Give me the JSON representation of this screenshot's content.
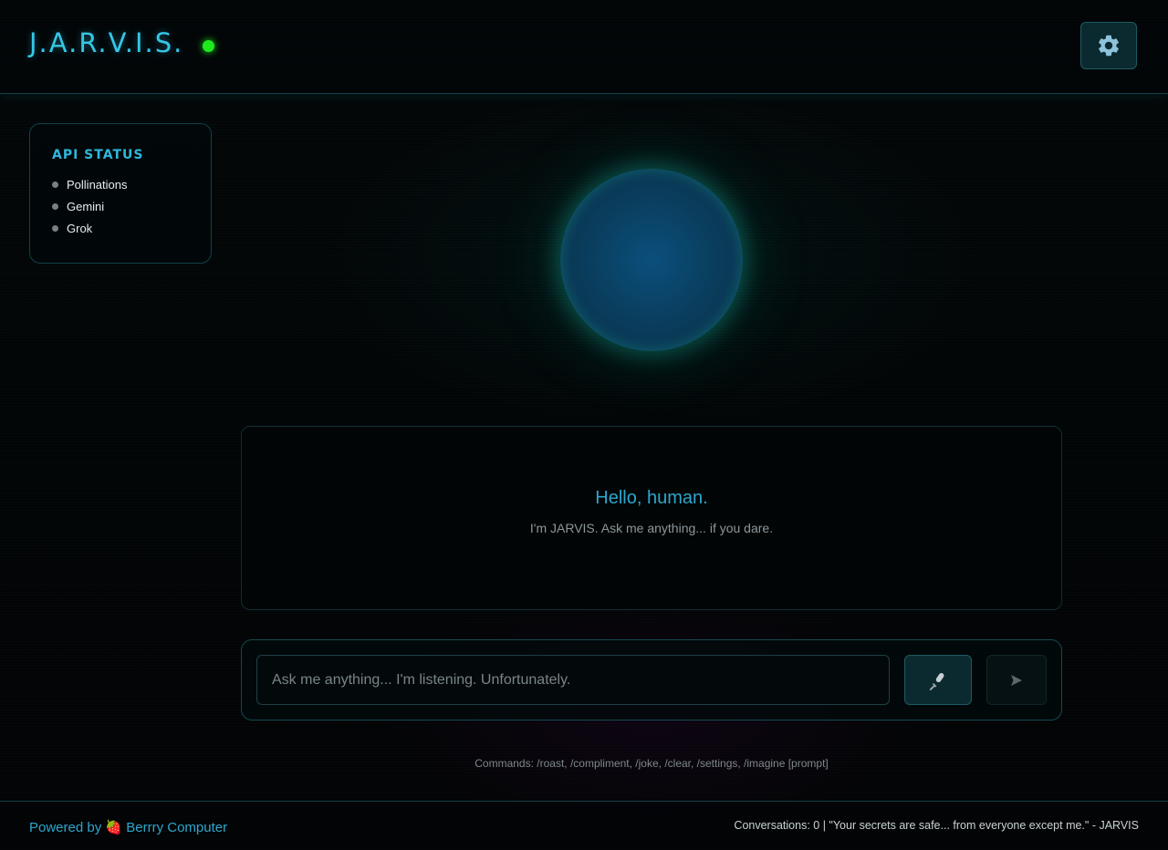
{
  "header": {
    "logo": "J.A.R.V.I.S.",
    "status_color": "#1eea1e",
    "settings_icon": "gear-icon"
  },
  "api_status": {
    "title": "API STATUS",
    "items": [
      {
        "label": "Pollinations"
      },
      {
        "label": "Gemini"
      },
      {
        "label": "Grok"
      }
    ]
  },
  "chat": {
    "greeting": "Hello, human.",
    "subtitle": "I'm JARVIS. Ask me anything... if you dare."
  },
  "input": {
    "placeholder": "Ask me anything... I'm listening. Unfortunately.",
    "value": "",
    "mic_icon": "microphone-icon",
    "send_icon": "send-arrow-icon"
  },
  "commands_hint": "Commands: /roast, /compliment, /joke, /clear, /settings, /imagine [prompt]",
  "footer": {
    "powered_prefix": "Powered by",
    "powered_emoji": "🍓",
    "powered_name": "Berrry Computer",
    "right_text": "Conversations: 0 | \"Your secrets are safe... from everyone except me.\" - JARVIS"
  },
  "colors": {
    "accent": "#36c6e6",
    "accent_dim": "#2ea6cc",
    "border": "#124a52",
    "status_ok": "#1eea1e",
    "status_idle": "#7a7f82"
  }
}
